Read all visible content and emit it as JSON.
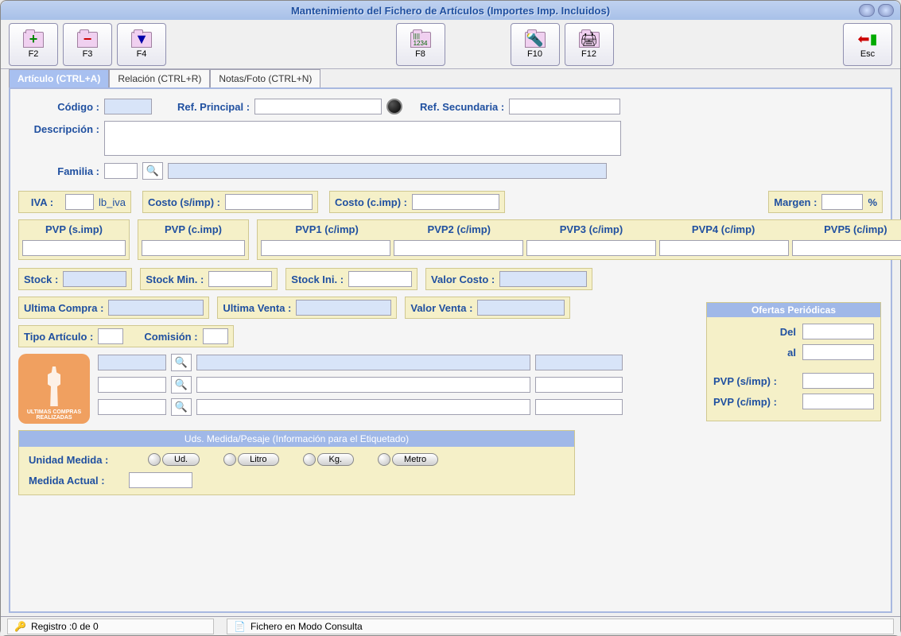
{
  "title": "Mantenimiento del Fichero de Artículos (Importes Imp. Incluidos)",
  "toolbar": {
    "f2": "F2",
    "f3": "F3",
    "f4": "F4",
    "f8": "F8",
    "f10": "F10",
    "f12": "F12",
    "esc": "Esc"
  },
  "tabs": {
    "articulo": "Artículo (CTRL+A)",
    "relacion": "Relación (CTRL+R)",
    "notas": "Notas/Foto (CTRL+N)"
  },
  "labels": {
    "codigo": "Código :",
    "ref_principal": "Ref. Principal :",
    "ref_secundaria": "Ref. Secundaria :",
    "descripcion": "Descripción :",
    "familia": "Familia :",
    "iva": "IVA :",
    "iva_unit": "lb_iva",
    "costo_simp": "Costo (s/imp) :",
    "costo_cimp": "Costo (c.imp) :",
    "margen": "Margen :",
    "margen_unit": "%",
    "pvp_simp": "PVP  (s.imp)",
    "pvp_cimp": "PVP (c.imp)",
    "pvp1": "PVP1 (c/imp)",
    "pvp2": "PVP2 (c/imp)",
    "pvp3": "PVP3 (c/imp)",
    "pvp4": "PVP4 (c/imp)",
    "pvp5": "PVP5 (c/imp)",
    "stock": "Stock :",
    "stock_min": "Stock Min. :",
    "stock_ini": "Stock Ini. :",
    "valor_costo": "Valor Costo :",
    "ultima_compra": "Ultima Compra :",
    "ultima_venta": "Ultima Venta :",
    "valor_venta": "Valor Venta :",
    "tipo_articulo": "Tipo Artículo :",
    "comision": "Comisión :",
    "compras_badge": "ULTIMAS COMPRAS REALIZADAS",
    "ofertas_title": "Ofertas Periódicas",
    "del": "Del",
    "al": "al",
    "ofertas_pvp_simp": "PVP (s/imp) :",
    "ofertas_pvp_cimp": "PVP (c/imp) :",
    "medida_title": "Uds. Medida/Pesaje (Información para el Etiquetado)",
    "unidad_medida": "Unidad Medida :",
    "medida_actual": "Medida Actual :",
    "ud": "Ud.",
    "litro": "Litro",
    "kg": "Kg.",
    "metro": "Metro"
  },
  "values": {
    "codigo": "",
    "ref_principal": "",
    "ref_secundaria": "",
    "descripcion": "",
    "familia_code": "",
    "familia_desc": "",
    "iva": "",
    "costo_simp": "",
    "costo_cimp": "",
    "margen": "",
    "pvp_simp": "",
    "pvp_cimp": "",
    "pvp1": "",
    "pvp2": "",
    "pvp3": "",
    "pvp4": "",
    "pvp5": "",
    "stock": "",
    "stock_min": "",
    "stock_ini": "",
    "valor_costo": "",
    "ultima_compra": "",
    "ultima_venta": "",
    "valor_venta": "",
    "tipo_articulo": "",
    "comision": "",
    "ofertas_del": "",
    "ofertas_al": "",
    "ofertas_pvp_simp": "",
    "ofertas_pvp_cimp": "",
    "medida_actual": ""
  },
  "status": {
    "registro": "Registro :0  de 0",
    "modo": "Fichero en Modo Consulta"
  }
}
